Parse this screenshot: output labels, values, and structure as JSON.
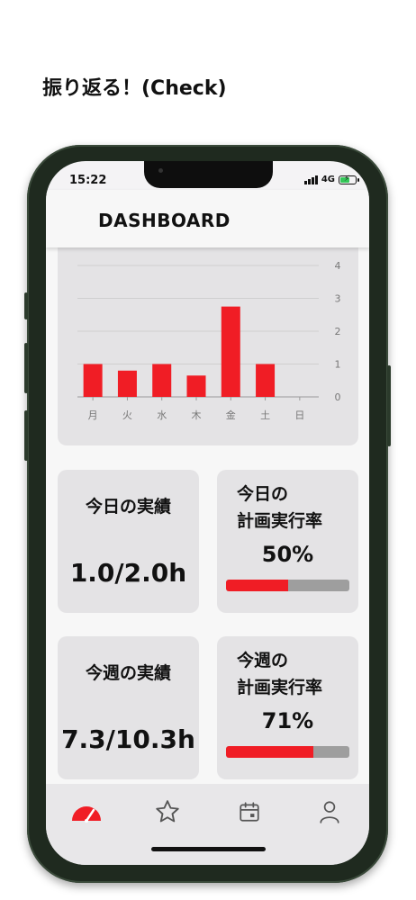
{
  "caption": "振り返る！(Check)",
  "status": {
    "time": "15:22",
    "network": "4G"
  },
  "header": {
    "title": "DASHBOARD"
  },
  "chart_data": {
    "type": "bar",
    "categories": [
      "月",
      "火",
      "水",
      "木",
      "金",
      "土",
      "日"
    ],
    "values": [
      1.0,
      0.8,
      1.0,
      0.65,
      2.75,
      1.0,
      0
    ],
    "ylim": [
      0,
      4
    ],
    "yticks": [
      "0",
      "1",
      "2",
      "3",
      "4"
    ],
    "grid": true,
    "y_axis_side": "right",
    "color": "#f01d25"
  },
  "cards": {
    "today_actual": {
      "label": "今日の実績",
      "value": "1.0/2.0h"
    },
    "today_rate": {
      "label": "今日の\n計画実行率",
      "percent_text": "50%",
      "fraction": 0.5
    },
    "week_actual": {
      "label": "今週の実績",
      "value": "7.3/10.3h"
    },
    "week_rate": {
      "label": "今週の\n計画実行率",
      "percent_text": "71%",
      "fraction": 0.71
    }
  },
  "colors": {
    "accent": "#f01d25",
    "card_bg": "#e4e3e5",
    "track": "#9e9e9e"
  },
  "tabs": [
    {
      "icon": "speedometer-icon",
      "active": true
    },
    {
      "icon": "star-icon",
      "active": false
    },
    {
      "icon": "calendar-icon",
      "active": false
    },
    {
      "icon": "person-icon",
      "active": false
    }
  ]
}
